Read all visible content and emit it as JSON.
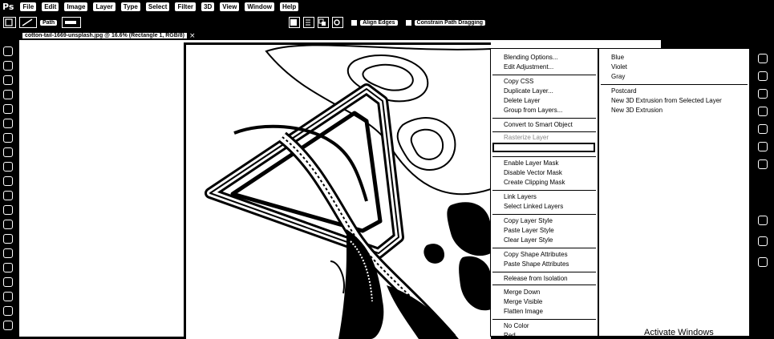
{
  "app": {
    "logo": "Ps"
  },
  "menubar": [
    "File",
    "Edit",
    "Image",
    "Layer",
    "Type",
    "Select",
    "Filter",
    "3D",
    "View",
    "Window",
    "Help"
  ],
  "options": {
    "mode": "Path",
    "chip": "Align Edges",
    "constrain": "Constrain Path Dragging"
  },
  "document_tab": {
    "title": "cotton-tail-1669-unsplash.jpg @ 16.6% (Rectangle 1, RGB/8)"
  },
  "context_menu": {
    "items": [
      {
        "label": "Blending Options...",
        "disabled": false
      },
      {
        "label": "Edit Adjustment...",
        "disabled": false
      },
      {
        "label": "Copy CSS",
        "disabled": false
      },
      {
        "label": "Duplicate Layer...",
        "disabled": false
      },
      {
        "label": "Delete Layer",
        "disabled": false
      },
      {
        "label": "Group from Layers...",
        "disabled": false
      },
      {
        "label": "Convert to Smart Object",
        "disabled": false
      },
      {
        "label": "Rasterize Layer",
        "disabled": true
      },
      {
        "label": "",
        "disabled": false
      },
      {
        "label": "Enable Layer Mask",
        "disabled": false
      },
      {
        "label": "Disable Vector Mask",
        "disabled": false
      },
      {
        "label": "Create Clipping Mask",
        "disabled": false
      },
      {
        "label": "Link Layers",
        "disabled": false
      },
      {
        "label": "Select Linked Layers",
        "disabled": false
      },
      {
        "label": "Copy Layer Style",
        "disabled": false
      },
      {
        "label": "Paste Layer Style",
        "disabled": false
      },
      {
        "label": "Clear Layer Style",
        "disabled": false
      },
      {
        "label": "Copy Shape Attributes",
        "disabled": false
      },
      {
        "label": "Paste Shape Attributes",
        "disabled": false
      },
      {
        "label": "Release from Isolation",
        "disabled": false
      },
      {
        "label": "Merge Down",
        "disabled": false
      },
      {
        "label": "Merge Visible",
        "disabled": false
      },
      {
        "label": "Flatten Image",
        "disabled": false
      },
      {
        "label": "No Color",
        "disabled": false
      },
      {
        "label": "Red",
        "disabled": false
      }
    ]
  },
  "submenu": {
    "items": [
      "Blue",
      "Violet",
      "Gray",
      "Postcard",
      "New 3D Extrusion from Selected Layer",
      "New 3D Extrusion"
    ]
  },
  "watermark": "Activate Windows"
}
